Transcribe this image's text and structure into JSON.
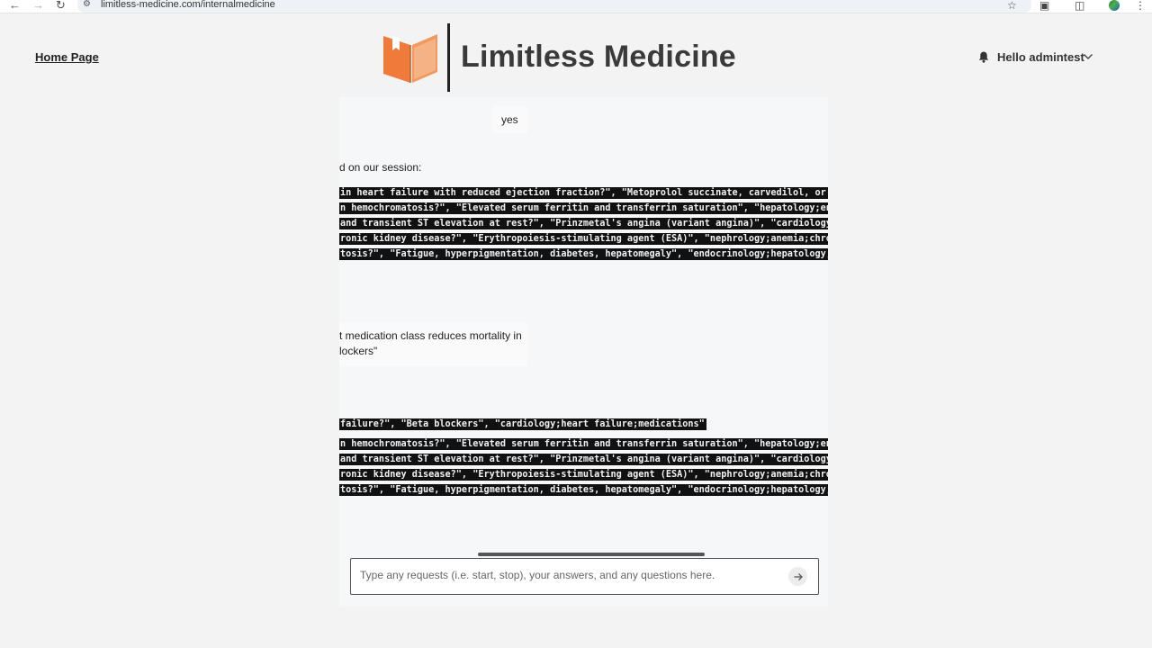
{
  "browser": {
    "url": "limitless-medicine.com/internalmedicine"
  },
  "header": {
    "home_link": "Home Page",
    "brand": "Limitless Medicine",
    "greeting": "Hello admintest"
  },
  "chat": {
    "user_message": "yes",
    "assistant_intro": "d on our session:",
    "code_block_1": [
      " in heart failure with reduced ejection fraction?\", \"Metoprolol succinate, carvedilol, or bisop",
      "n hemochromatosis?\", \"Elevated serum ferritin and transferrin saturation\", \"hepatology;endocrin",
      " and transient ST elevation at rest?\", \"Prinzmetal's angina (variant angina)\", \"cardiology;angi",
      "ronic kidney disease?\", \"Erythropoiesis-stimulating agent (ESA)\", \"nephrology;anemia;chronic ki",
      "tosis?\", \"Fatigue, hyperpigmentation, diabetes, hepatomegaly\", \"endocrinology;hepatology;iron o"
    ],
    "question_lines": [
      "t medication class reduces mortality in",
      "lockers\""
    ],
    "code_block_2": [
      " failure?\", \"Beta blockers\", \"cardiology;heart failure;medications\"",
      "n hemochromatosis?\", \"Elevated serum ferritin and transferrin saturation\", \"hepatology;endocrin",
      " and transient ST elevation at rest?\", \"Prinzmetal's angina (variant angina)\", \"cardiology;angi",
      "ronic kidney disease?\", \"Erythropoiesis-stimulating agent (ESA)\", \"nephrology;anemia;chronic ki",
      "tosis?\", \"Fatigue, hyperpigmentation, diabetes, hepatomegaly\", \"endocrinology;hepatology;iron o"
    ]
  },
  "input": {
    "placeholder": "Type any requests (i.e. start, stop), your answers, and any questions here.",
    "value": ""
  },
  "icons": {
    "back": "back-arrow-icon",
    "forward": "forward-arrow-icon",
    "reload": "reload-icon",
    "site_info": "site-info-icon",
    "star": "bookmark-star-icon",
    "extensions": "extensions-icon",
    "cast": "cast-icon",
    "profile": "profile-avatar-icon",
    "menu": "kebab-menu-icon",
    "logo": "open-book-icon",
    "bell": "bell-icon",
    "chevron": "chevron-down-icon",
    "send": "send-arrow-icon"
  },
  "colors": {
    "brand_orange": "#f07a3a",
    "page_bg": "#f3f3f3",
    "panel_bg": "#f6f7f9",
    "code_bg": "#111111"
  }
}
